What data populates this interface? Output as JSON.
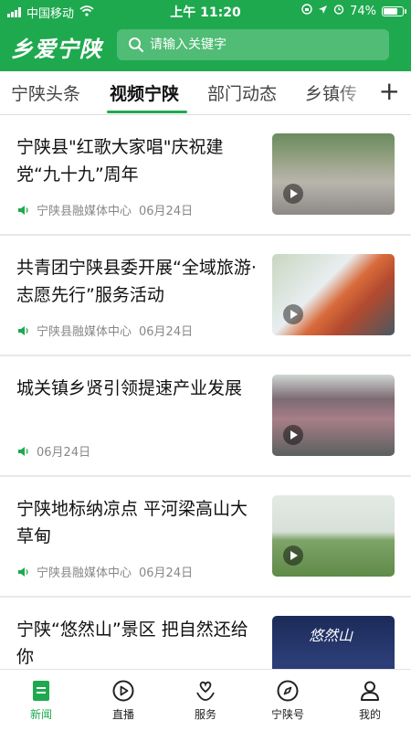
{
  "status_bar": {
    "carrier": "中国移动",
    "time": "上午 11:20",
    "battery": "74%"
  },
  "app": {
    "logo": "乡爱宁陕",
    "search_placeholder": "请输入关键字"
  },
  "tabs": [
    {
      "label": "宁陕头条"
    },
    {
      "label": "视频宁陕"
    },
    {
      "label": "部门动态"
    },
    {
      "label": "乡镇传"
    }
  ],
  "active_tab": "视频宁陕",
  "news": [
    {
      "title": "宁陕县\"红歌大家唱\"庆祝建党“九十九”周年",
      "source": "宁陕县融媒体中心",
      "date": "06月24日"
    },
    {
      "title": "共青团宁陕县委开展“全域旅游·志愿先行”服务活动",
      "source": "宁陕县融媒体中心",
      "date": "06月24日"
    },
    {
      "title": "城关镇乡贤引领提速产业发展",
      "source": "",
      "date": "06月24日"
    },
    {
      "title": "宁陕地标纳凉点 平河梁高山大草甸",
      "source": "宁陕县融媒体中心",
      "date": "06月24日"
    },
    {
      "title": "宁陕“悠然山”景区 把自然还给你",
      "source": "",
      "date": "",
      "thumb_text": "悠然山"
    }
  ],
  "bottom_nav": [
    {
      "label": "新闻",
      "icon": "news-icon",
      "active": true
    },
    {
      "label": "直播",
      "icon": "play-circle-icon",
      "active": false
    },
    {
      "label": "服务",
      "icon": "heart-hand-icon",
      "active": false
    },
    {
      "label": "宁陕号",
      "icon": "compass-icon",
      "active": false
    },
    {
      "label": "我的",
      "icon": "user-icon",
      "active": false
    }
  ],
  "colors": {
    "brand_green": "#1fa94f"
  }
}
